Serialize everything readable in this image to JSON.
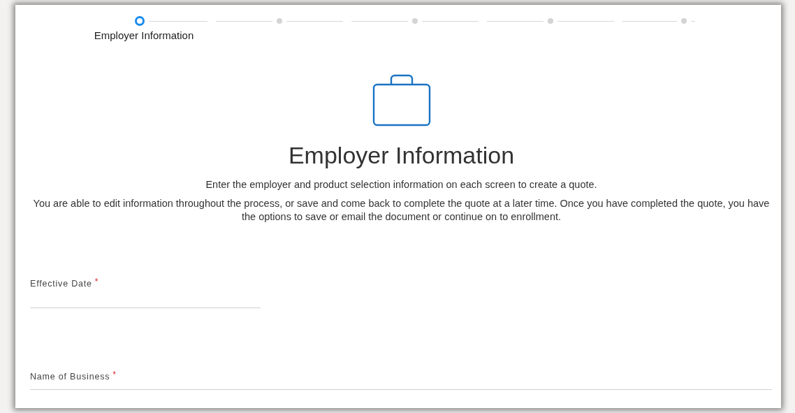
{
  "stepper": {
    "steps": [
      {
        "label": "Employer Information",
        "selected": true
      },
      {
        "selected": false
      },
      {
        "selected": false
      },
      {
        "selected": false
      },
      {
        "selected": false
      }
    ]
  },
  "heading": "Employer Information",
  "intro": "Enter the employer and product selection information on each screen to create a quote.",
  "description": "You are able to edit information throughout the process, or save and come back to complete the quote at a later time. Once you have completed the quote, you have the options to save or email the document or continue on to enrollment.",
  "fields": [
    {
      "label": "Effective Date",
      "required_mark": "*",
      "kind": "short"
    },
    {
      "label": "Name of Business",
      "required_mark": "*",
      "kind": "wide"
    }
  ]
}
